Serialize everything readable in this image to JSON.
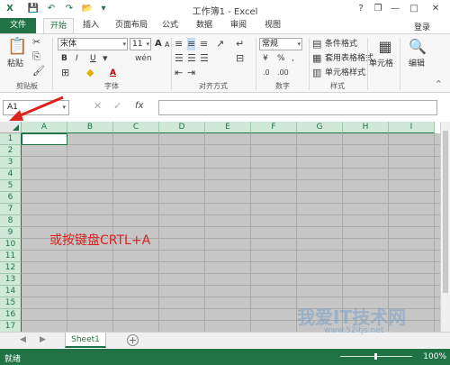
{
  "window": {
    "title": "工作簿1 - Excel",
    "help": "?",
    "minimize": "—",
    "restore": "❐",
    "maximize": "□",
    "close": "✕"
  },
  "quick_access": {
    "save": "💾",
    "undo": "↶",
    "redo": "↷",
    "open": "📂",
    "more": "▾"
  },
  "tabs": [
    {
      "label": "文件"
    },
    {
      "label": "开始"
    },
    {
      "label": "插入"
    },
    {
      "label": "页面布局"
    },
    {
      "label": "公式"
    },
    {
      "label": "数据"
    },
    {
      "label": "审阅"
    },
    {
      "label": "视图"
    }
  ],
  "login_label": "登录",
  "ribbon": {
    "clipboard": {
      "label": "剪贴板",
      "paste": "粘贴"
    },
    "font": {
      "label": "字体",
      "name": "宋体",
      "size": "11",
      "bold": "B",
      "italic": "I",
      "underline": "U",
      "grow": "A",
      "shrink": "A",
      "fontcolor": "A",
      "wen": "wén"
    },
    "alignment": {
      "label": "对齐方式"
    },
    "number": {
      "label": "数字",
      "format": "常规",
      "percent": "%",
      "comma": ",",
      "currency": "¥"
    },
    "styles": {
      "label": "样式",
      "conditional": "条件格式",
      "table": "套用表格格式",
      "cell": "单元格样式"
    },
    "cells": {
      "label": "单元格"
    },
    "editing": {
      "label": "编辑"
    }
  },
  "formula_bar": {
    "name_box": "A1",
    "fx": "fx",
    "cancel": "✕",
    "enter": "✓"
  },
  "columns": [
    "A",
    "B",
    "C",
    "D",
    "E",
    "F",
    "G",
    "H",
    "I"
  ],
  "rows": [
    "1",
    "2",
    "3",
    "4",
    "5",
    "6",
    "7",
    "8",
    "9",
    "10",
    "11",
    "12",
    "13",
    "14",
    "15",
    "16",
    "17"
  ],
  "annotation": "或按键盘CRTL+A",
  "sheets": [
    {
      "name": "Sheet1"
    }
  ],
  "add_sheet": "+",
  "status": {
    "ready": "就绪",
    "zoom": "100%"
  },
  "watermark": {
    "text": "我爱IT技术网",
    "url": "www.52itjs.net"
  },
  "colors": {
    "accent": "#217346",
    "annotation": "#e0201c",
    "grid_fill": "#c6c6c6"
  }
}
